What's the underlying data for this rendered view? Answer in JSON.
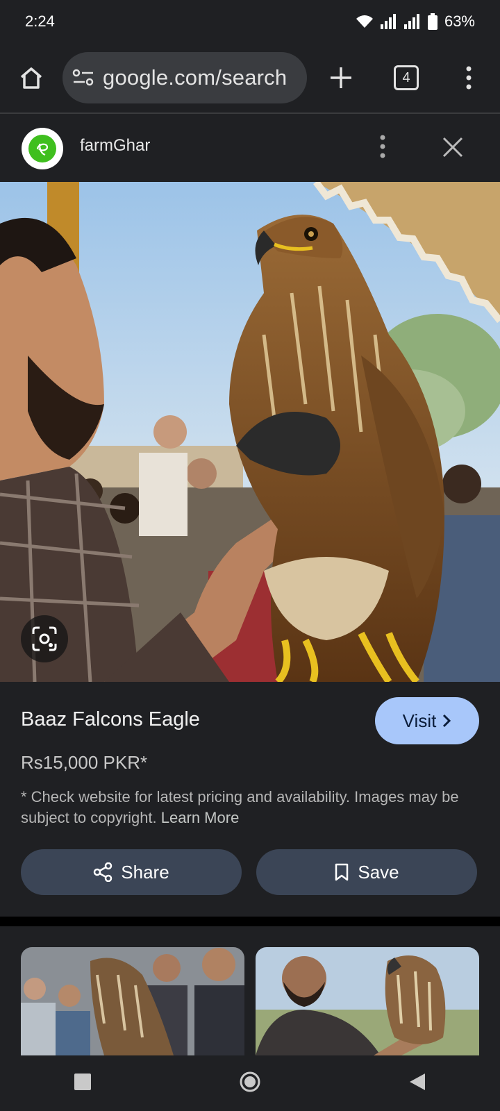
{
  "status": {
    "time": "2:24",
    "battery": "63%"
  },
  "toolbar": {
    "url": "google.com/search",
    "tab_count": "4"
  },
  "site": {
    "name": "farmGhar"
  },
  "product": {
    "title": "Baaz Falcons Eagle",
    "visit_label": "Visit",
    "price": "Rs15,000 PKR*",
    "disclaimer": "* Check website for latest pricing and availability. Images may be subject to copyright.",
    "learn_more": "Learn More",
    "share_label": "Share",
    "save_label": "Save"
  },
  "colors": {
    "accent": "#a8c7fa",
    "button_bg": "#3b4556",
    "background": "#1f2023"
  },
  "icons": [
    "home-icon",
    "site-info-icon",
    "new-tab-icon",
    "tab-switcher-icon",
    "menu-icon",
    "close-icon",
    "lens-icon",
    "share-icon",
    "bookmark-icon",
    "chevron-right-icon"
  ]
}
